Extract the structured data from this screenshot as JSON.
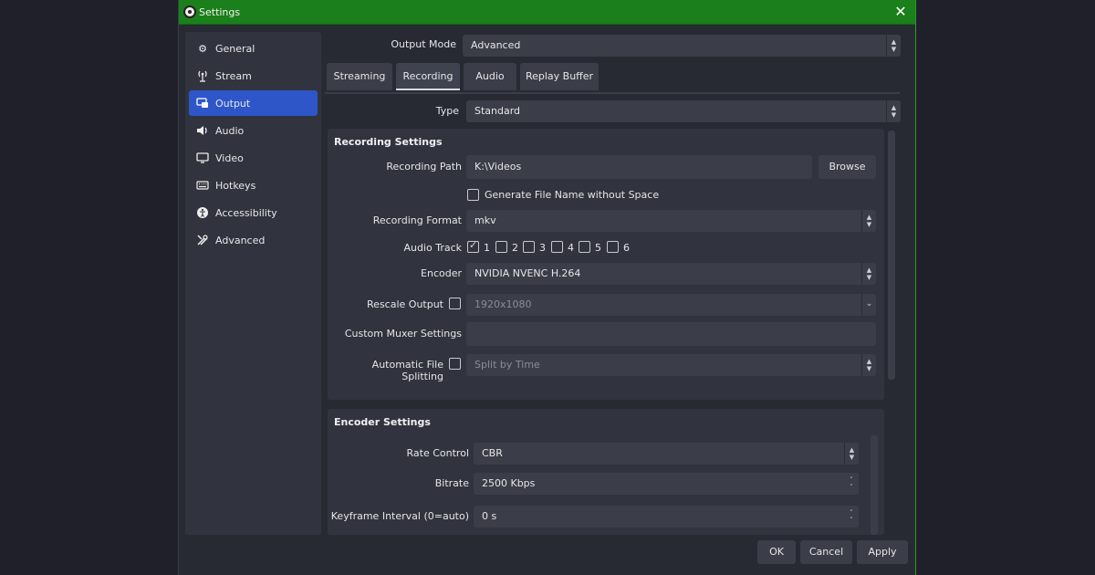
{
  "window": {
    "title": "Settings"
  },
  "sidebar": {
    "items": [
      {
        "label": "General",
        "icon": "gear-icon"
      },
      {
        "label": "Stream",
        "icon": "antenna-icon"
      },
      {
        "label": "Output",
        "icon": "output-icon",
        "active": true
      },
      {
        "label": "Audio",
        "icon": "speaker-icon"
      },
      {
        "label": "Video",
        "icon": "monitor-icon"
      },
      {
        "label": "Hotkeys",
        "icon": "keyboard-icon"
      },
      {
        "label": "Accessibility",
        "icon": "accessibility-icon"
      },
      {
        "label": "Advanced",
        "icon": "tools-icon"
      }
    ]
  },
  "output_mode": {
    "label": "Output Mode",
    "value": "Advanced"
  },
  "tabs": [
    {
      "label": "Streaming"
    },
    {
      "label": "Recording",
      "active": true
    },
    {
      "label": "Audio"
    },
    {
      "label": "Replay Buffer"
    }
  ],
  "type": {
    "label": "Type",
    "value": "Standard"
  },
  "recording_settings": {
    "title": "Recording Settings",
    "path": {
      "label": "Recording Path",
      "value": "K:\\Videos",
      "browse": "Browse"
    },
    "generate_name": {
      "label": "Generate File Name without Space",
      "checked": false
    },
    "format": {
      "label": "Recording Format",
      "value": "mkv"
    },
    "audio_track": {
      "label": "Audio Track",
      "tracks": [
        {
          "num": "1",
          "checked": true
        },
        {
          "num": "2",
          "checked": false
        },
        {
          "num": "3",
          "checked": false
        },
        {
          "num": "4",
          "checked": false
        },
        {
          "num": "5",
          "checked": false
        },
        {
          "num": "6",
          "checked": false
        }
      ]
    },
    "encoder": {
      "label": "Encoder",
      "value": "NVIDIA NVENC H.264"
    },
    "rescale": {
      "label": "Rescale Output",
      "value": "1920x1080",
      "checked": false
    },
    "muxer": {
      "label": "Custom Muxer Settings",
      "value": ""
    },
    "splitting": {
      "label": "Automatic File Splitting",
      "value": "Split by Time",
      "checked": false
    }
  },
  "encoder_settings": {
    "title": "Encoder Settings",
    "rate_control": {
      "label": "Rate Control",
      "value": "CBR"
    },
    "bitrate": {
      "label": "Bitrate",
      "value": "2500 Kbps"
    },
    "keyframe": {
      "label": "Keyframe Interval (0=auto)",
      "value": "0 s"
    }
  },
  "footer": {
    "ok": "OK",
    "cancel": "Cancel",
    "apply": "Apply"
  }
}
